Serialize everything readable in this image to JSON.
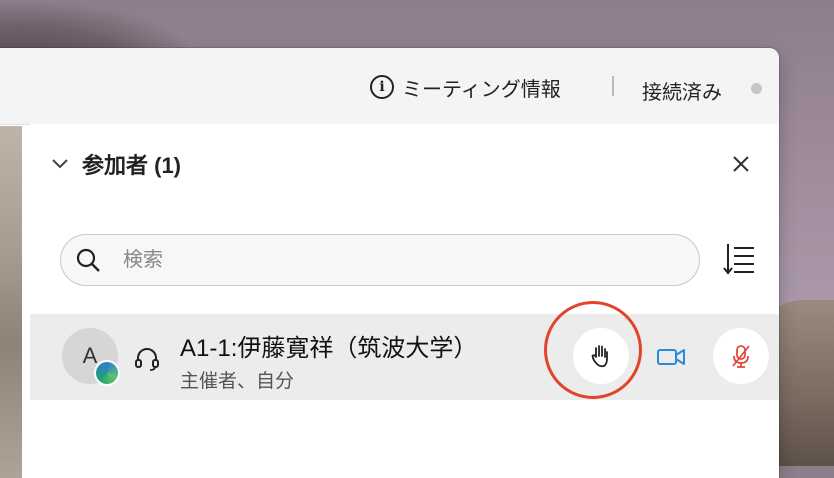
{
  "topbar": {
    "meeting_info_label": "ミーティング情報",
    "status_label": "接続済み"
  },
  "panel": {
    "title": "参加者 (1)",
    "search_placeholder": "検索"
  },
  "participants": [
    {
      "initial": "A",
      "name": "A1-1:伊藤寛祥（筑波大学）",
      "role": "主催者、自分"
    }
  ],
  "icons": {
    "info": "info-circle-icon",
    "chevron": "chevron-down-icon",
    "close": "close-icon",
    "search": "search-icon",
    "sort": "sort-icon",
    "headset": "headset-icon",
    "raise_hand": "raise-hand-icon",
    "video": "video-camera-icon",
    "muted_mic": "microphone-muted-icon"
  },
  "colors": {
    "video_icon": "#2d8ad6",
    "mute_icon": "#e04a3c",
    "highlight": "#e2432b"
  }
}
